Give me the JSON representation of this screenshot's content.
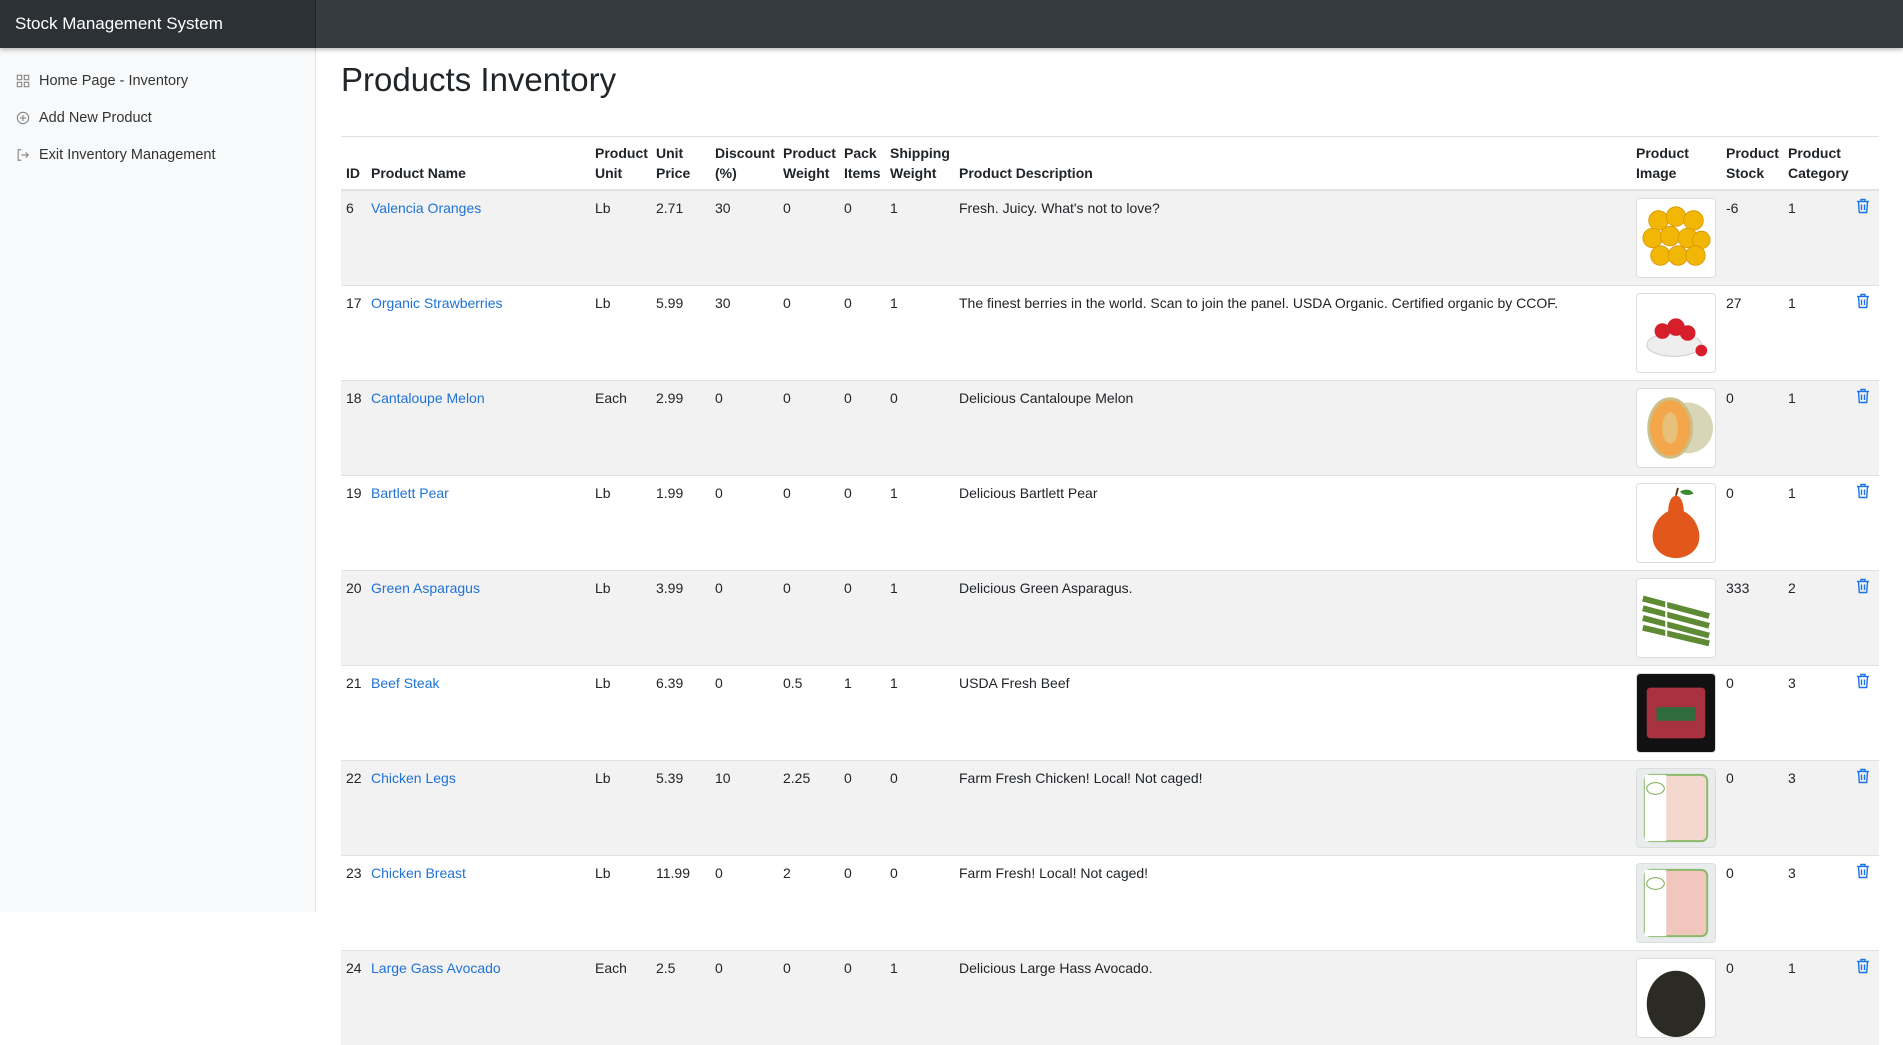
{
  "app": {
    "title": "Stock Management System"
  },
  "sidebar": {
    "items": [
      {
        "label": "Home Page - Inventory",
        "icon": "grid-icon"
      },
      {
        "label": "Add New Product",
        "icon": "plus-circle-icon"
      },
      {
        "label": "Exit Inventory Management",
        "icon": "log-out-icon"
      }
    ]
  },
  "page": {
    "title": "Products Inventory"
  },
  "table": {
    "headers": {
      "id": "ID",
      "name": "Product Name",
      "unit": "Product Unit",
      "price": "Unit Price",
      "discount": "Discount (%)",
      "weight": "Product Weight",
      "pack": "Pack Items",
      "shipping": "Shipping Weight",
      "description": "Product Description",
      "image": "Product Image",
      "stock": "Product Stock",
      "category": "Product Category"
    },
    "rows": [
      {
        "id": "6",
        "name": "Valencia Oranges",
        "unit": "Lb",
        "price": "2.71",
        "discount": "30",
        "weight": "0",
        "pack": "0",
        "shipping": "1",
        "description": "Fresh. Juicy. What's not to love?",
        "image": "oranges-image",
        "stock": "-6",
        "category": "1"
      },
      {
        "id": "17",
        "name": "Organic Strawberries",
        "unit": "Lb",
        "price": "5.99",
        "discount": "30",
        "weight": "0",
        "pack": "0",
        "shipping": "1",
        "description": "The finest berries in the world. Scan to join the panel. USDA Organic. Certified organic by CCOF.",
        "image": "strawberries-image",
        "stock": "27",
        "category": "1"
      },
      {
        "id": "18",
        "name": "Cantaloupe Melon",
        "unit": "Each",
        "price": "2.99",
        "discount": "0",
        "weight": "0",
        "pack": "0",
        "shipping": "0",
        "description": "Delicious Cantaloupe Melon",
        "image": "melon-image",
        "stock": "0",
        "category": "1"
      },
      {
        "id": "19",
        "name": "Bartlett Pear",
        "unit": "Lb",
        "price": "1.99",
        "discount": "0",
        "weight": "0",
        "pack": "0",
        "shipping": "1",
        "description": "Delicious Bartlett Pear",
        "image": "pear-image",
        "stock": "0",
        "category": "1"
      },
      {
        "id": "20",
        "name": "Green Asparagus",
        "unit": "Lb",
        "price": "3.99",
        "discount": "0",
        "weight": "0",
        "pack": "0",
        "shipping": "1",
        "description": "Delicious Green Asparagus.",
        "image": "asparagus-image",
        "stock": "333",
        "category": "2"
      },
      {
        "id": "21",
        "name": "Beef Steak",
        "unit": "Lb",
        "price": "6.39",
        "discount": "0",
        "weight": "0.5",
        "pack": "1",
        "shipping": "1",
        "description": "USDA Fresh Beef",
        "image": "beef-image",
        "stock": "0",
        "category": "3"
      },
      {
        "id": "22",
        "name": "Chicken Legs",
        "unit": "Lb",
        "price": "5.39",
        "discount": "10",
        "weight": "2.25",
        "pack": "0",
        "shipping": "0",
        "description": "Farm Fresh Chicken! Local! Not caged!",
        "image": "chicken-legs-image",
        "stock": "0",
        "category": "3"
      },
      {
        "id": "23",
        "name": "Chicken Breast",
        "unit": "Lb",
        "price": "11.99",
        "discount": "0",
        "weight": "2",
        "pack": "0",
        "shipping": "0",
        "description": "Farm Fresh! Local! Not caged!",
        "image": "chicken-breast-image",
        "stock": "0",
        "category": "3"
      },
      {
        "id": "24",
        "name": "Large Gass Avocado",
        "unit": "Each",
        "price": "2.5",
        "discount": "0",
        "weight": "0",
        "pack": "0",
        "shipping": "1",
        "description": "Delicious Large Hass Avocado.",
        "image": "avocado-image",
        "stock": "0",
        "category": "1"
      }
    ]
  },
  "colors": {
    "link": "#1f72d6",
    "topbar": "#343a40",
    "trash": "#1a73e8"
  }
}
